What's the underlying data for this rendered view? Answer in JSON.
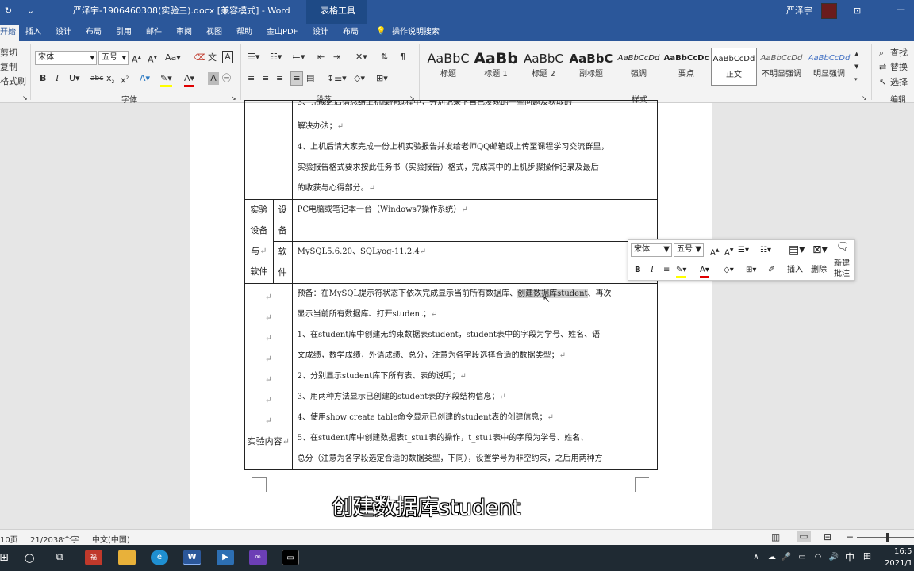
{
  "title_bar": {
    "title": "严泽宇-1906460308(实验三).docx [兼容模式] - Word",
    "context_label": "表格工具",
    "user": "严泽宇",
    "colors": {
      "bar": "#2b579a"
    }
  },
  "ribbon_tabs": [
    "开始",
    "插入",
    "设计",
    "布局",
    "引用",
    "邮件",
    "审阅",
    "视图",
    "帮助",
    "金山PDF",
    "设计",
    "布局"
  ],
  "tell_me": "操作说明搜索",
  "clipboard": {
    "cut": "剪切",
    "copy": "复制",
    "painter": "格式刷"
  },
  "font_group": {
    "font_name": "宋体",
    "font_size": "五号",
    "label": "字体"
  },
  "paragraph_group": {
    "label": "段落"
  },
  "styles_group": {
    "label": "样式",
    "items": [
      {
        "preview": "AaBbC",
        "name": "标题"
      },
      {
        "preview": "AaBb",
        "name": "标题 1"
      },
      {
        "preview": "AaBbC",
        "name": "标题 2"
      },
      {
        "preview": "AaBbC",
        "name": "副标题"
      },
      {
        "preview": "AaBbCcDd",
        "name": "强调"
      },
      {
        "preview": "AaBbCcDc",
        "name": "要点"
      },
      {
        "preview": "AaBbCcDd",
        "name": "正文"
      },
      {
        "preview": "AaBbCcDd",
        "name": "不明显强调"
      },
      {
        "preview": "AaBbCcDd",
        "name": "明显强调"
      }
    ]
  },
  "editing_group": {
    "find": "查找",
    "replace": "替换",
    "select": "选择",
    "label": "编辑"
  },
  "document": {
    "top_lines": [
      "3、完成之后请总结上机操作过程中，分别记录下自己发现的一些问题及获取的",
      "解决办法；",
      "4、上机后请大家完成一份上机实验报告并发给老师QQ邮箱或上传至课程学习交流群里，",
      "实验报告格式要求按此任务书（实验报告）格式，完成其中的上机步骤操作记录及最后",
      "的收获与心得部分。"
    ],
    "equipment_label": [
      "实验",
      "设备",
      "与",
      "软件"
    ],
    "hardware_label": [
      "设",
      "备"
    ],
    "hardware_value": "PC电脑或笔记本一台（Windows7操作系统）",
    "software_label": [
      "软",
      "件"
    ],
    "software_value": "MySQL5.6.20、SQLyog-11.2.4",
    "content_label": "实验内容",
    "content_prefix": "预备：在MySQL提示符状态下依次完成显示当前所有数据库、",
    "content_highlight": "创建数据库student",
    "content_suffix": "、再次",
    "content_lines": [
      "显示当前所有数据库、打开student；",
      "1、在student库中创建无约束数据表student，student表中的字段为学号、姓名、语",
      "文成绩，数学成绩，外语成绩、总分，注意为各字段选择合适的数据类型；",
      "2、分别显示student库下所有表、表的说明；",
      "3、用两种方法显示已创建的student表的字段结构信息；",
      "4、使用show create table命令显示已创建的student表的创建信息；",
      "5、在student库中创建数据表t_stu1表的操作，t_stu1表中的字段为学号、姓名、",
      "总分（注意为各字段选定合适的数据类型，下同），设置学号为非空约束，之后用两种方"
    ]
  },
  "mini_toolbar": {
    "font": "宋体",
    "size": "五号",
    "insert": "插入",
    "delete": "删除",
    "new_comment": [
      "新建",
      "批注"
    ]
  },
  "subtitle": "创建数据库student",
  "status_bar": {
    "page": "10页",
    "words": "21/2038个字",
    "language": "中文(中国)"
  },
  "taskbar": {
    "ime": "中",
    "time": "16:5",
    "date": "2021/1"
  }
}
